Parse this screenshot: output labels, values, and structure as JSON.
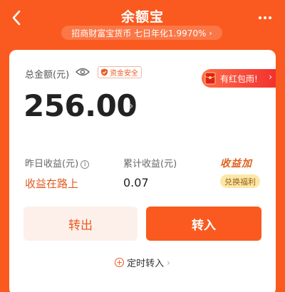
{
  "header": {
    "title": "余额宝",
    "subtitle": "招商财富宝货币 七日年化1.9970%",
    "subtitle_chevron": "›"
  },
  "balance": {
    "label": "总金额(元)",
    "safe_badge": "资金安全",
    "amount": "256.00",
    "amount_chevron": "›"
  },
  "promo_banner": {
    "text": "有红包雨!",
    "chevron": "›"
  },
  "stats": {
    "yesterday_label": "昨日收益(元)",
    "info_glyph": "i",
    "yesterday_value": "收益在路上",
    "cumulative_label": "累计收益(元)",
    "cumulative_value": "0.07"
  },
  "bonus": {
    "title": "收益加",
    "tag": "兑换福利"
  },
  "actions": {
    "transfer_out": "转出",
    "transfer_in": "转入"
  },
  "scheduled": {
    "plus_glyph": "+",
    "label": "定时转入",
    "chevron": "›"
  },
  "colors": {
    "brand_orange": "#fa5a1f",
    "accent_text": "#ec5a23"
  },
  "icons": [
    "back-arrow-icon",
    "more-dots-icon",
    "eye-icon",
    "shield-icon",
    "red-envelope-icon",
    "info-icon",
    "plus-circle-icon",
    "chevron-right-icon"
  ]
}
